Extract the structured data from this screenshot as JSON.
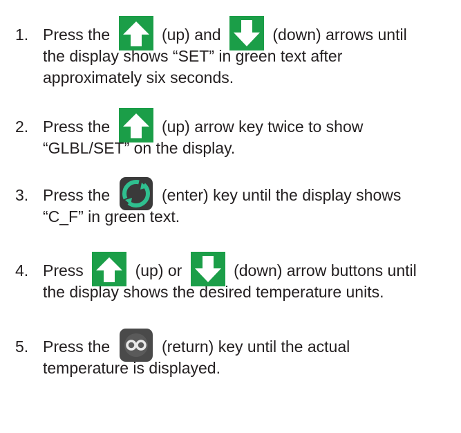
{
  "steps": [
    {
      "number": "1.",
      "before_icon1": "Press the",
      "icon1": "up-arrow-icon",
      "between_icons": "(up) and",
      "icon2": "down-arrow-icon",
      "after_icon2": "(down) arrows until",
      "line2": "the display shows “SET” in green text after",
      "line3": "approximately six seconds."
    },
    {
      "number": "2.",
      "before_icon": "Press the",
      "icon": "up-arrow-icon",
      "after_icon": "(up) arrow key twice to show",
      "line2": "“GLBL/SET” on the display."
    },
    {
      "number": "3.",
      "before_icon": "Press the",
      "icon": "enter-key-icon",
      "after_icon": "(enter) key until the display shows",
      "line2": "“C_F” in green text."
    },
    {
      "number": "4.",
      "before_icon1": "Press",
      "icon1": "up-arrow-icon",
      "between_icons": "(up) or",
      "icon2": "down-arrow-icon",
      "after_icon2": "(down) arrow buttons until",
      "line2": "the display shows the desired temperature units."
    },
    {
      "number": "5.",
      "before_icon": "Press the",
      "icon": "return-key-icon",
      "after_icon": "(return) key until the actual",
      "line2": "temperature is displayed."
    }
  ],
  "colors": {
    "text": "#231f20",
    "arrow_bg": "#1b9e48",
    "enter_ring": "#2fbf8f",
    "key_bg": "#3a3a3a"
  }
}
